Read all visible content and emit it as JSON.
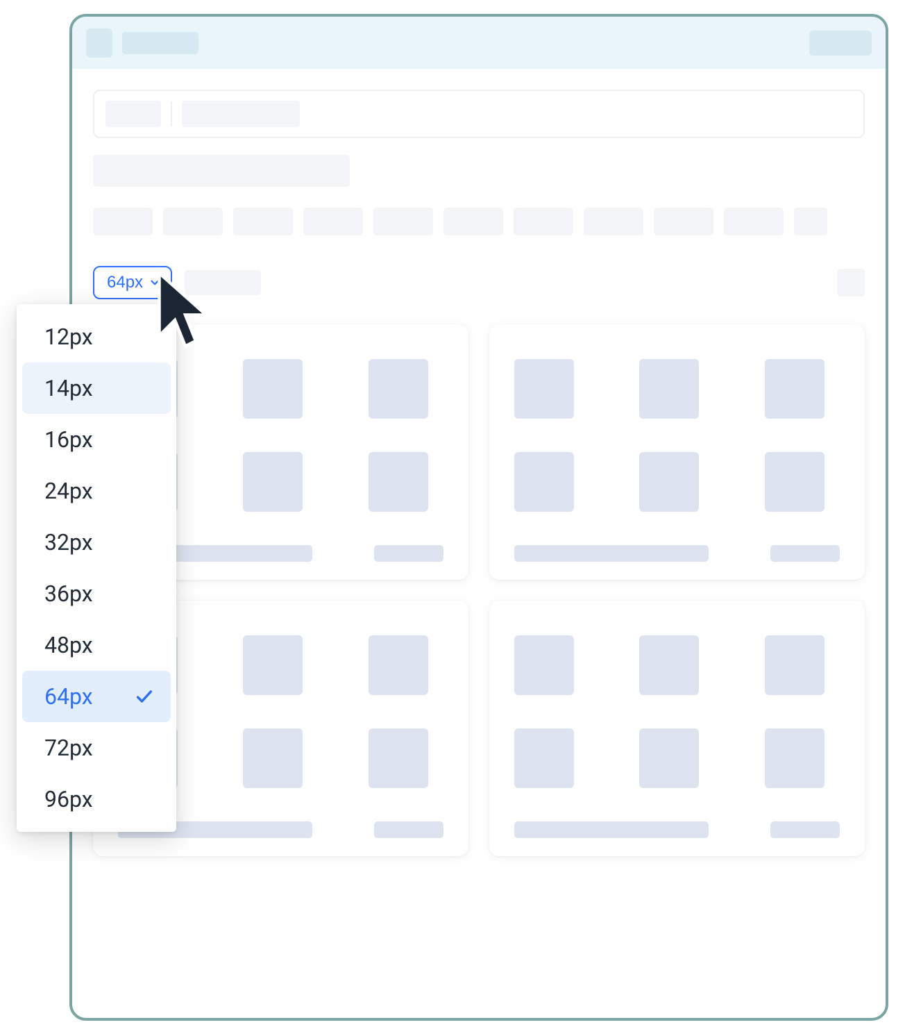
{
  "size_selector": {
    "current": "64px",
    "options": [
      {
        "label": "12px",
        "state": "normal"
      },
      {
        "label": "14px",
        "state": "hover"
      },
      {
        "label": "16px",
        "state": "normal"
      },
      {
        "label": "24px",
        "state": "normal"
      },
      {
        "label": "32px",
        "state": "normal"
      },
      {
        "label": "36px",
        "state": "normal"
      },
      {
        "label": "48px",
        "state": "normal"
      },
      {
        "label": "64px",
        "state": "selected"
      },
      {
        "label": "72px",
        "state": "normal"
      },
      {
        "label": "96px",
        "state": "normal"
      }
    ]
  },
  "colors": {
    "accent": "#2d6ff5",
    "window_border": "#7ba5a5",
    "titlebar_bg": "#eaf5fa",
    "placeholder_light": "#f3f5f7",
    "placeholder_thumb": "#dde4f0"
  }
}
